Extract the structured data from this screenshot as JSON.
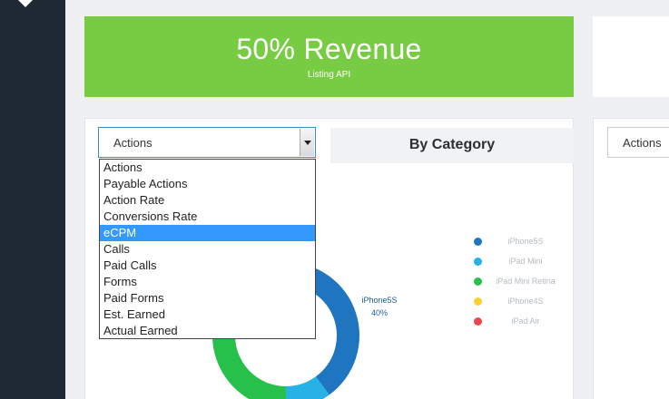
{
  "revenue": {
    "title": "50% Revenue",
    "subtitle": "Listing API"
  },
  "metric_select": {
    "value": "Actions",
    "options": [
      "Actions",
      "Payable Actions",
      "Action Rate",
      "Conversions Rate",
      "eCPM",
      "Calls",
      "Paid Calls",
      "Forms",
      "Paid Forms",
      "Est. Earned",
      "Actual Earned"
    ],
    "highlighted": "eCPM"
  },
  "panel_title": "By Category",
  "right_select": {
    "value": "Actions"
  },
  "colors": {
    "brand_green": "#77cc44",
    "sidebar": "#1e2933",
    "highlight": "#3399ff"
  },
  "chart_data": {
    "type": "pie",
    "donut": true,
    "categories": [
      "iPhone5S",
      "iPad Mini",
      "iPad Mini Retina",
      "iPhone4S",
      "iPad Air"
    ],
    "values": [
      40,
      10,
      35,
      15,
      0
    ],
    "colors": [
      "#1f75c0",
      "#26b2e6",
      "#27c04a",
      "#fbcf33",
      "#e9474f"
    ],
    "data_label": {
      "name": "iPhone5S",
      "value": "40%"
    },
    "legend_position": "right"
  }
}
